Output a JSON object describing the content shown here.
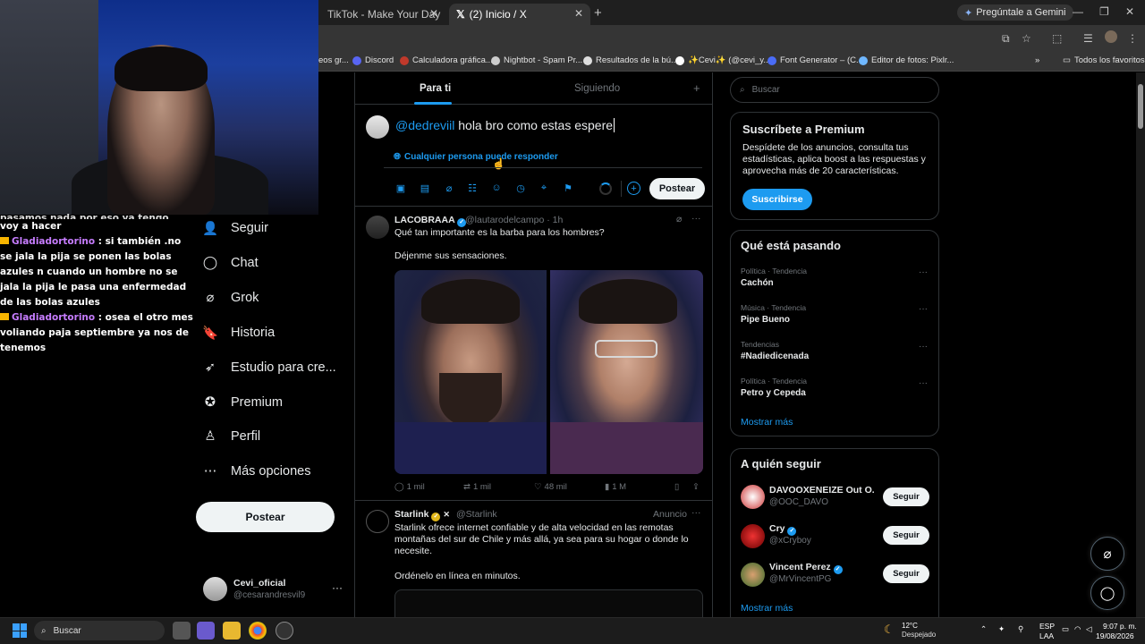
{
  "browser": {
    "tabs": [
      {
        "title": "TikTok - Make Your Day"
      },
      {
        "title": "(2) Inicio / X"
      }
    ],
    "gemini_label": "Pregúntale a Gemini",
    "bookmarks": [
      "eos gr...",
      "Discord",
      "Calculadora gráfica...",
      "Nightbot - Spam Pr...",
      "Resultados de la bú...",
      "✨Cevi✨ (@cevi_y...",
      "Font Generator – (C...",
      "Editor de fotos: Pixlr..."
    ],
    "all_bookmarks": "Todos los favoritos"
  },
  "chat": {
    "lines": [
      {
        "name": "",
        "text": "voy a hacer"
      },
      {
        "name": "Gladiadortorino",
        "text": ": si también .no se jala la pija se ponen las bolas azules n cuando un hombre no se jala la pija le pasa una enfermedad de las bolas azules"
      },
      {
        "name": "Gladiadortorino",
        "text": ": osea el otro mes voliando paja septiembre ya nos de tenemos"
      }
    ],
    "partial_top": "pasamos nada por eso ya tengo mucho"
  },
  "nav": {
    "items": [
      {
        "label": "Seguir",
        "icon": "person-plus-icon"
      },
      {
        "label": "Chat",
        "icon": "chat-bubble-icon"
      },
      {
        "label": "Grok",
        "icon": "grok-icon"
      },
      {
        "label": "Historia",
        "icon": "bookmark-icon"
      },
      {
        "label": "Estudio para cre...",
        "icon": "rocket-icon"
      },
      {
        "label": "Premium",
        "icon": "verified-icon"
      },
      {
        "label": "Perfil",
        "icon": "person-icon"
      },
      {
        "label": "Más opciones",
        "icon": "more-circle-icon"
      }
    ],
    "post_button": "Postear",
    "account": {
      "name": "Cevi_oficial",
      "handle": "@cesarandresvil9"
    }
  },
  "feed": {
    "tabs": [
      "Para ti",
      "Siguiendo"
    ],
    "compose": {
      "mention": "@dedreviil",
      "text": " hola bro como estas espere",
      "reply_setting": "Cualquier persona puede responder",
      "post_button": "Postear"
    },
    "tweets": [
      {
        "name": "LACOBRAAA",
        "handle": "@lautarodelcampo · 1h",
        "text1": "Qué tan importante es la barba para los hombres?",
        "text2": "Déjenme sus sensaciones.",
        "replies": "1 mil",
        "retweets": "1 mil",
        "likes": "48 mil",
        "views": "1 M"
      },
      {
        "name": "Starlink",
        "handle": "@Starlink",
        "ad_label": "Anuncio",
        "text1": "Starlink ofrece internet confiable y de alta velocidad en las remotas montañas del sur de Chile y más allá, ya sea para su hogar o donde lo necesite.",
        "text2": "Ordénelo en línea en minutos."
      }
    ]
  },
  "sidebar": {
    "search_placeholder": "Buscar",
    "premium": {
      "title": "Suscríbete a Premium",
      "body": "Despídete de los anuncios, consulta tus estadísticas, aplica boost a las respuestas y aprovecha más de 20 características.",
      "button": "Suscribirse"
    },
    "trends": {
      "title": "Qué está pasando",
      "items": [
        {
          "category": "Política · Tendencia",
          "name": "Cachón"
        },
        {
          "category": "Música · Tendencia",
          "name": "Pipe Bueno"
        },
        {
          "category": "Tendencias",
          "name": "#Nadiedicenada"
        },
        {
          "category": "Política · Tendencia",
          "name": "Petro y Cepeda"
        }
      ],
      "show_more": "Mostrar más"
    },
    "who_to_follow": {
      "title": "A quién seguir",
      "items": [
        {
          "name": "DAVOOXENEIZE Out O...",
          "handle": "@OOC_DAVO",
          "button": "Seguir"
        },
        {
          "name": "Cry",
          "handle": "@xCryboy",
          "button": "Seguir"
        },
        {
          "name": "Vincent Perez",
          "handle": "@MrVincentPG",
          "button": "Seguir"
        }
      ],
      "show_more": "Mostrar más"
    }
  },
  "taskbar": {
    "search": "Buscar",
    "weather_temp": "12°C",
    "weather_desc": "Despejado",
    "lang1": "ESP",
    "lang2": "LAA",
    "time": "9:07 p. m.",
    "date": "19/08/2026"
  },
  "colors": {
    "accent": "#1d9bf0",
    "chat_name": "#c77dff"
  }
}
